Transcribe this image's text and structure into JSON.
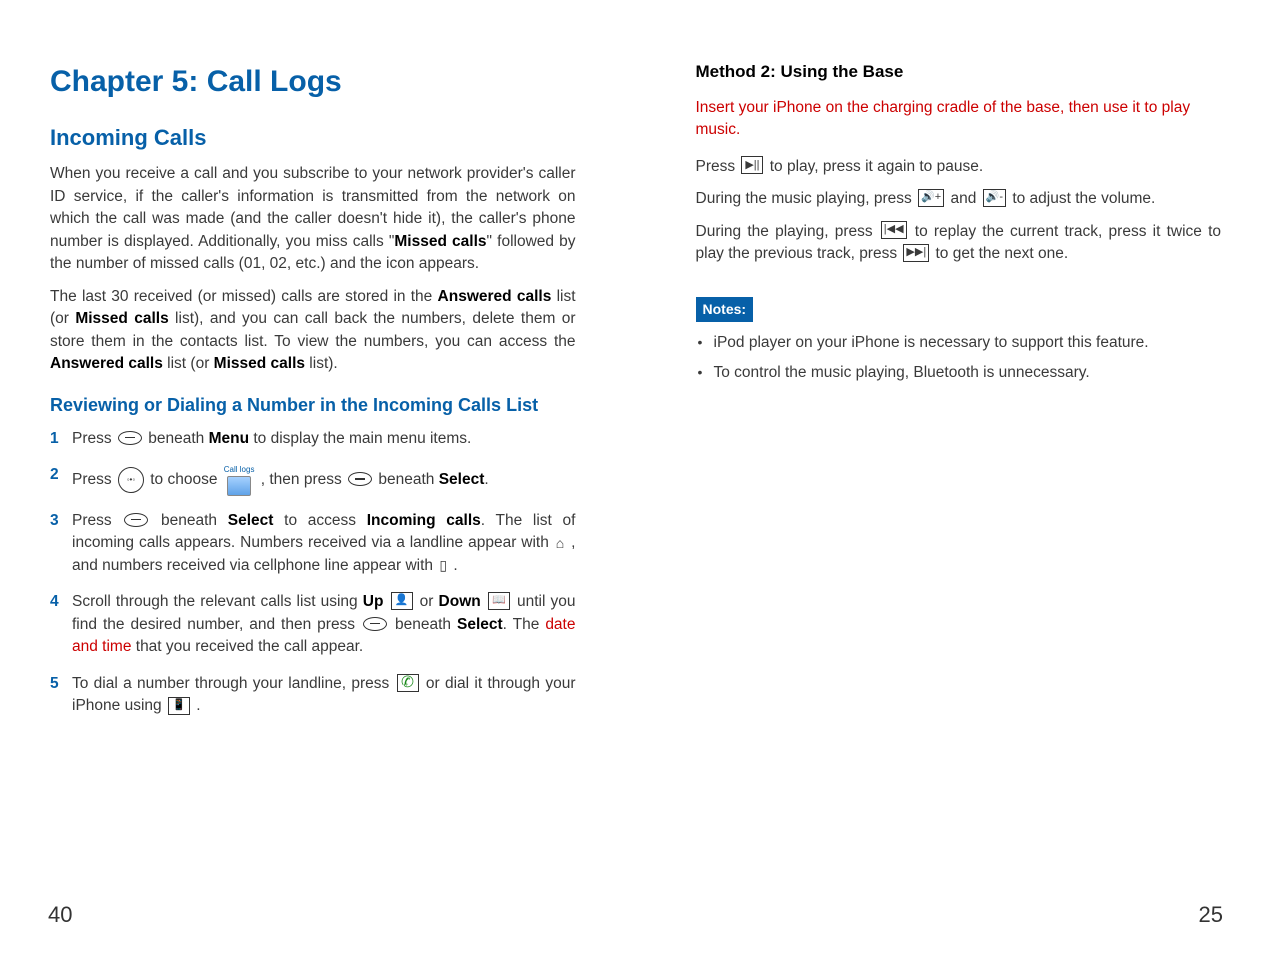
{
  "left": {
    "chapter_title": "Chapter 5: Call Logs",
    "h2": "Incoming Calls",
    "p1a": "When you receive a call and you subscribe to your network provider's caller ID service, if the caller's information is transmitted from the network on which the call was made (and the caller doesn't hide it), the caller's phone number is displayed. Additionally, you miss calls \"",
    "p1b_bold": "Missed calls",
    "p1c": "\" followed by the number of missed calls (01, 02, etc.) and the icon appears.",
    "p2a": "The last 30 received (or missed) calls are stored in the ",
    "p2b_bold": "Answered calls",
    "p2c": " list (or ",
    "p2d_bold": "Missed calls",
    "p2e": " list), and you can call back the numbers, delete them or store them in the contacts list. To view the numbers, you can access the ",
    "p2f_bold": "Answered calls",
    "p2g": " list (or ",
    "p2h_bold": "Missed calls",
    "p2i": " list).",
    "h3": "Reviewing or Dialing a Number in the Incoming Calls List",
    "s1a": "Press ",
    "s1b": " beneath ",
    "s1c_bold": "Menu",
    "s1d": " to display the main menu items.",
    "s2a": "Press ",
    "s2b": " to choose ",
    "s2c": " , then press ",
    "s2d": " beneath ",
    "s2e_bold": "Select",
    "s2f": ".",
    "calllogs_label": "Call logs",
    "s3a": "Press ",
    "s3b": " beneath ",
    "s3c_bold": "Select",
    "s3d": " to access ",
    "s3e_bold": "Incoming calls",
    "s3f": ". The list of incoming calls appears. Numbers received via a landline appear with ",
    "s3g": " , and numbers received via cellphone line appear with ",
    "s3h": " .",
    "s4a": "Scroll through the relevant calls list using ",
    "s4b_bold": "Up",
    "s4c": " or ",
    "s4d_bold": "Down",
    "s4e": " until you find the desired number, and then press ",
    "s4f": " beneath ",
    "s4g_bold": "Select",
    "s4h": ". The ",
    "s4i_red": "date and time",
    "s4j": " that you received the call appear.",
    "s5a": "To dial a number through your landline, press ",
    "s5b": " or dial it through your iPhone using ",
    "s5c": " .",
    "nums": {
      "n1": "1",
      "n2": "2",
      "n3": "3",
      "n4": "4",
      "n5": "5"
    },
    "page_number": "40"
  },
  "right": {
    "method_title": "Method 2: Using the Base",
    "redpara": "Insert your iPhone on the charging cradle of the base, then use it to play music.",
    "p1a": "Press ",
    "p1b": " to play, press it again to pause.",
    "p2a": "During the music playing, press ",
    "p2b": " and ",
    "p2c": " to adjust the volume.",
    "p3a": "During the playing, press ",
    "p3b": " to replay the current track, press it twice to play the previous track, press ",
    "p3c": " to get the next one.",
    "notes_label": "Notes:",
    "note1": "iPod player on your iPhone is necessary to support this feature.",
    "note2": "To control the music playing, Bluetooth is unnecessary.",
    "page_number": "25"
  },
  "icons": {
    "play_pause": "▶||",
    "vol_up": "🔊+",
    "vol_down": "🔊-",
    "prev": "|◀◀",
    "next": "▶▶|",
    "up_contact": "👤",
    "down_book": "📖",
    "house": "⌂",
    "mobile": "▯",
    "phone_green": "✆",
    "phone_blue": "📱"
  }
}
